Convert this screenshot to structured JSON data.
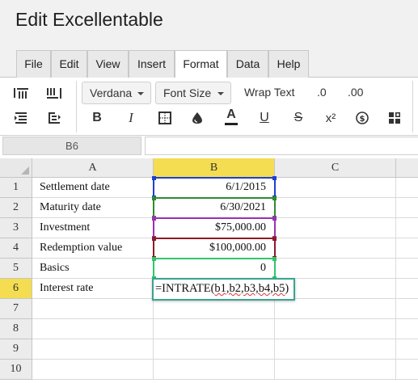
{
  "app": {
    "title": "Edit Excellentable"
  },
  "menu": {
    "tabs": [
      {
        "label": "File"
      },
      {
        "label": "Edit"
      },
      {
        "label": "View"
      },
      {
        "label": "Insert"
      },
      {
        "label": "Format",
        "active": true
      },
      {
        "label": "Data"
      },
      {
        "label": "Help"
      }
    ]
  },
  "toolbar": {
    "font_dropdown": "Verdana",
    "font_size_dropdown": "Font Size",
    "wrap_text": "Wrap Text",
    "decrease_decimal": ".0",
    "increase_decimal": ".00",
    "bold": "B",
    "italic": "I",
    "font_color": "A",
    "underline": "U",
    "strikethrough": "S",
    "superscript": "x²"
  },
  "formula_bar": {
    "cell_ref": "B6",
    "value": ""
  },
  "grid": {
    "columns": [
      "A",
      "B",
      "C"
    ],
    "active_column": "B",
    "active_row": "6",
    "rows": [
      {
        "num": "1",
        "a": "Settlement date",
        "b": "6/1/2015"
      },
      {
        "num": "2",
        "a": "Maturity date",
        "b": "6/30/2021"
      },
      {
        "num": "3",
        "a": "Investment",
        "b": "$75,000.00"
      },
      {
        "num": "4",
        "a": "Redemption value",
        "b": "$100,000.00"
      },
      {
        "num": "5",
        "a": "Basics",
        "b": "0"
      },
      {
        "num": "6",
        "a": "Interest rate",
        "b": ""
      },
      {
        "num": "7",
        "a": "",
        "b": ""
      },
      {
        "num": "8",
        "a": "",
        "b": ""
      },
      {
        "num": "9",
        "a": "",
        "b": ""
      },
      {
        "num": "10",
        "a": "",
        "b": ""
      }
    ]
  },
  "editor": {
    "func": "=INTRATE(",
    "args": "b1,b2,b3,b4,b5",
    "close": ")"
  },
  "colors": {
    "active_header": "#f4dd50",
    "ref_b1": "#1f3fd1",
    "ref_b2": "#2e8b2e",
    "ref_b3": "#9b2fb3",
    "ref_b4": "#8b1a2a",
    "ref_b5": "#2ec66a",
    "editor_border": "#3aa38f"
  }
}
